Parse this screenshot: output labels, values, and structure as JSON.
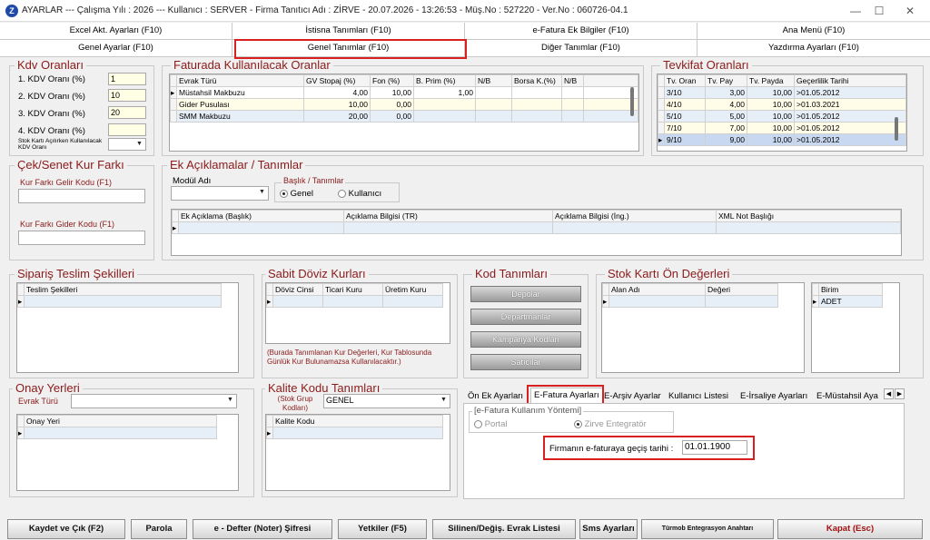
{
  "titlebar": {
    "icon_letter": "Z",
    "text": "AYARLAR  ---  Çalışma Yılı : 2026  ---  Kullanıcı : SERVER - Firma Tanıtıcı Adı : ZİRVE - 20.07.2026 - 13:26:53 - Müş.No : 527220 - Ver.No : 060726-04.1",
    "min": "—",
    "max": "☐",
    "close": "✕"
  },
  "tabs_top": [
    "Excel Akt. Ayarları (F10)",
    "İstisna Tanımları (F10)",
    "e-Fatura Ek Bilgiler (F10)",
    "Ana Menü (F10)"
  ],
  "tabs_bottom": [
    "Genel Ayarlar (F10)",
    "Genel Tanımlar (F10)",
    "Diğer Tanımlar (F10)",
    "Yazdırma Ayarları (F10)"
  ],
  "kdv": {
    "title": "Kdv Oranları",
    "rows": [
      {
        "label": "1. KDV Oranı (%)",
        "value": "1"
      },
      {
        "label": "2. KDV Oranı (%)",
        "value": "10"
      },
      {
        "label": "3. KDV Oranı (%)",
        "value": "20"
      },
      {
        "label": "4. KDV Oranı (%)",
        "value": ""
      }
    ],
    "stok_label": "Stok Kartı Açılırken Kullanılacak KDV Oranı"
  },
  "fatura": {
    "title": "Faturada Kullanılacak Oranlar",
    "headers": [
      "Evrak Türü",
      "GV Stopaj (%)",
      "Fon (%)",
      "B. Prim (%)",
      "N/B",
      "Borsa K.(%)",
      "N/B"
    ],
    "rows": [
      [
        "Müstahsil Makbuzu",
        "4,00",
        "10,00",
        "1,00",
        "",
        "",
        ""
      ],
      [
        "Gider Pusulası",
        "10,00",
        "0,00",
        "",
        "",
        "",
        ""
      ],
      [
        "SMM Makbuzu",
        "20,00",
        "0,00",
        "",
        "",
        "",
        ""
      ]
    ]
  },
  "tevkifat": {
    "title": "Tevkifat Oranları",
    "headers": [
      "Tv. Oran",
      "Tv. Pay",
      "Tv. Payda",
      "Geçerlilik Tarihi"
    ],
    "rows": [
      [
        "3/10",
        "3,00",
        "10,00",
        ">01.05.2012"
      ],
      [
        "4/10",
        "4,00",
        "10,00",
        ">01.03.2021"
      ],
      [
        "5/10",
        "5,00",
        "10,00",
        ">01.05.2012"
      ],
      [
        "7/10",
        "7,00",
        "10,00",
        ">01.05.2012"
      ],
      [
        "9/10",
        "9,00",
        "10,00",
        ">01.05.2012"
      ]
    ]
  },
  "cek": {
    "title": "Çek/Senet Kur Farkı",
    "gelir_label": "Kur Farkı Gelir Kodu (F1)",
    "gider_label": "Kur Farkı Gider Kodu (F1)"
  },
  "ek": {
    "title": "Ek Açıklamalar / Tanımlar",
    "modul_label": "Modül Adı",
    "baslik_label": "Başlık / Tanımlar",
    "radio_genel": "Genel",
    "radio_kullanici": "Kullanıcı",
    "headers": [
      "Ek Açıklama (Başlık)",
      "Açıklama Bilgisi (TR)",
      "Açıklama Bilgisi (İng.)",
      "XML Not Başlığı"
    ]
  },
  "siparis": {
    "title": "Sipariş Teslim Şekilleri",
    "header": "Teslim Şekilleri"
  },
  "doviz": {
    "title": "Sabit Döviz Kurları",
    "headers": [
      "Döviz Cinsi",
      "Ticari Kuru",
      "Üretim Kuru"
    ],
    "note": "(Burada Tanımlanan Kur Değerleri, Kur Tablosunda Günlük Kur Bulunamazsa Kullanılacaktır.)"
  },
  "kod": {
    "title": "Kod Tanımları",
    "buttons": [
      "Depolar",
      "Departmanlar",
      "Kampanya Kodları",
      "Satıcılar"
    ]
  },
  "stok": {
    "title": "Stok Kartı Ön Değerleri",
    "headers": [
      "Alan Adı",
      "Değeri"
    ],
    "birim_header": "Birim",
    "birim_value": "ADET"
  },
  "onay": {
    "title": "Onay Yerleri",
    "evrak_label": "Evrak Türü",
    "header": "Onay Yeri"
  },
  "kalite": {
    "title": "Kalite Kodu Tanımları",
    "stok_grup_label": "(Stok Grup Kodları)",
    "stok_grup_value": "GENEL",
    "header": "Kalite Kodu"
  },
  "subtabs": {
    "items": [
      "Ön Ek Ayarları",
      "E-Fatura Ayarları",
      "E-Arşiv Ayarlar",
      "Kullanıcı Listesi",
      "E-İrsaliye Ayarları",
      "E-Müstahsil Aya"
    ],
    "group_title": "[e-Fatura Kullanım Yöntemi]",
    "radio_portal": "Portal",
    "radio_zirve": "Zirve Entegratör",
    "gecis_label": "Firmanın e-faturaya geçiş tarihi :",
    "gecis_value": "01.01.1900"
  },
  "bottom": {
    "buttons": [
      "Kaydet ve Çık (F2)",
      "Parola",
      "e - Defter (Noter) Şifresi",
      "Yetkiler (F5)",
      "Silinen/Değiş. Evrak Listesi",
      "Sms Ayarları",
      "Türmob Entegrasyon Anahtarı",
      "Kapat (Esc)"
    ]
  },
  "colors": {
    "accent_red": "#d92020",
    "title_red": "#8b1a1a",
    "selected_row": "#c8d8f0"
  }
}
